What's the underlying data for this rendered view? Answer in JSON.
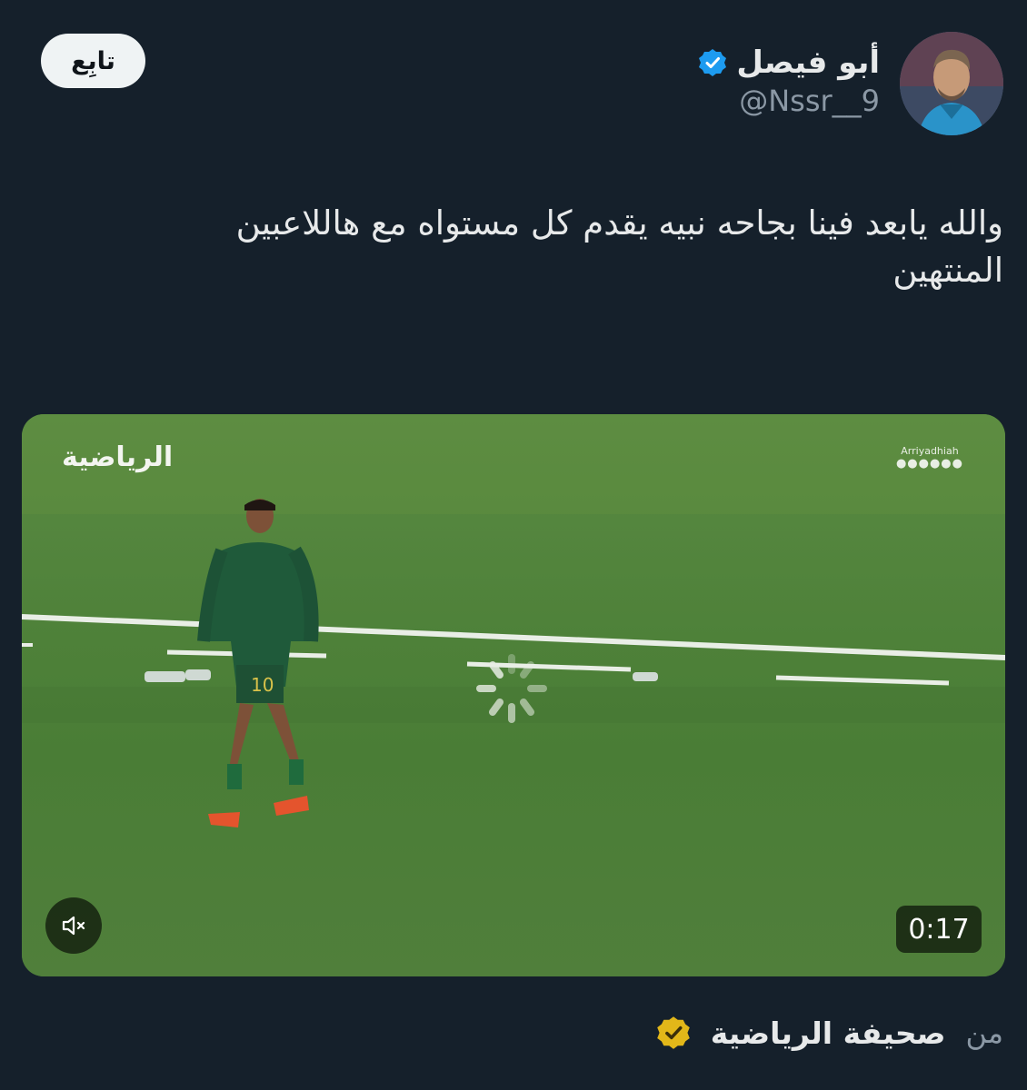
{
  "header": {
    "follow_label": "تابِع",
    "display_name": "أبو فيصل",
    "handle": "@Nssr__9",
    "verified_color": "#1d9bf0"
  },
  "tweet": {
    "text": "والله يابعد فينا بجاحه نبيه يقدم كل مستواه مع هاللاعبين المنتهين"
  },
  "media": {
    "watermark": "الرياضية",
    "channel_name": "Arriyadhiah",
    "player_number": "10",
    "duration": "0:17",
    "muted": true
  },
  "source": {
    "from_label": "من",
    "name": "صحيفة الرياضية",
    "badge_color": "#e2b719"
  }
}
